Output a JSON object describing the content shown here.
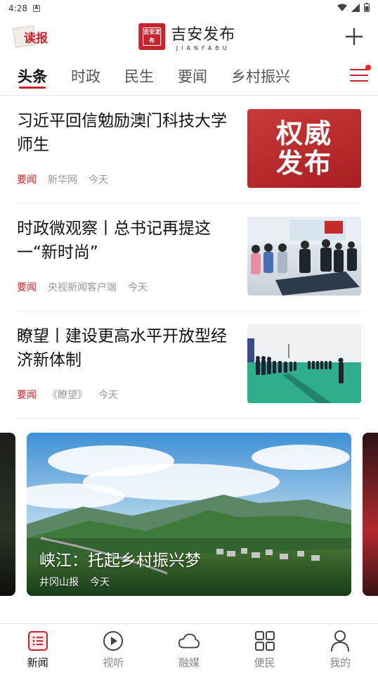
{
  "status_bar": {
    "time": "4:28",
    "notif_badge": "A"
  },
  "header": {
    "dubao_label": "读报",
    "logo_seal_chars": [
      "吉",
      "安",
      "发",
      "布"
    ],
    "logo_title": "吉安发布",
    "logo_subtitle": "JIANFABU",
    "add_icon": "plus-icon"
  },
  "tabs": [
    {
      "label": "头条",
      "active": true
    },
    {
      "label": "时政",
      "active": false
    },
    {
      "label": "民生",
      "active": false
    },
    {
      "label": "要闻",
      "active": false
    },
    {
      "label": "乡村振兴",
      "active": false
    }
  ],
  "news": [
    {
      "title": "习近平回信勉励澳门科技大学师生",
      "tag": "要闻",
      "source": "新华网",
      "time": "今天",
      "thumb_text": [
        "权威",
        "发布"
      ]
    },
    {
      "title": "时政微观察丨总书记再提这一“新时尚”",
      "tag": "要闻",
      "source": "央视新闻客户端",
      "time": "今天"
    },
    {
      "title": "瞭望丨建设更高水平开放型经济新体制",
      "tag": "要闻",
      "source": "《瞭望》",
      "time": "今天"
    }
  ],
  "carousel": {
    "title": "峡江：托起乡村振兴梦",
    "source": "井冈山报",
    "time": "今天"
  },
  "bottom_nav": [
    {
      "label": "新闻",
      "icon": "news-list-icon",
      "active": true
    },
    {
      "label": "视听",
      "icon": "play-icon",
      "active": false
    },
    {
      "label": "融媒",
      "icon": "cloud-icon",
      "active": false
    },
    {
      "label": "便民",
      "icon": "grid-icon",
      "active": false
    },
    {
      "label": "我的",
      "icon": "user-icon",
      "active": false
    }
  ],
  "colors": {
    "accent": "#c8232c",
    "muted": "#999999"
  }
}
